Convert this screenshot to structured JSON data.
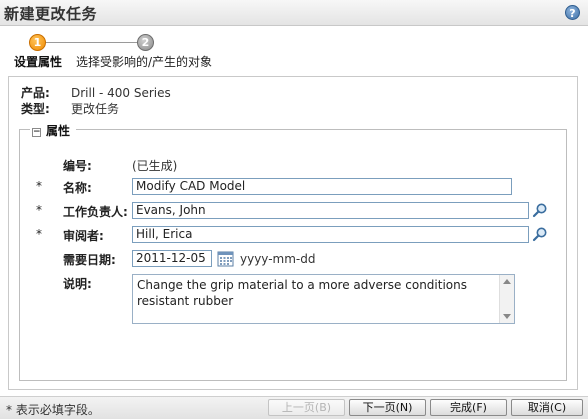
{
  "window": {
    "title": "新建更改任务",
    "help_icon": "?"
  },
  "wizard": {
    "steps": [
      {
        "number": "1",
        "label": "设置属性"
      },
      {
        "number": "2",
        "label": "选择受影响的/产生的对象"
      }
    ]
  },
  "info": {
    "product_label": "产品:",
    "product_value": "Drill - 400 Series",
    "type_label": "类型:",
    "type_value": "更改任务"
  },
  "attributes": {
    "section_title": "属性",
    "collapse_symbol": "−",
    "number_label": "编号:",
    "number_value": "(已生成)",
    "name_label": "名称:",
    "name_value": "Modify CAD Model",
    "assignee_label": "工作负责人:",
    "assignee_value": "Evans, John",
    "reviewer_label": "审阅者:",
    "reviewer_value": "Hill, Erica",
    "need_date_label": "需要日期:",
    "need_date_value": "2011-12-05",
    "date_format_hint": "yyyy-mm-dd",
    "description_label": "说明:",
    "description_value": "Change the grip material to a more adverse conditions resistant rubber",
    "required_marker": "*"
  },
  "footer": {
    "required_note": "* 表示必填字段。",
    "buttons": {
      "prev": "上一页(B)",
      "next": "下一页(N)",
      "finish": "完成(F)",
      "cancel": "取消(C)"
    }
  }
}
